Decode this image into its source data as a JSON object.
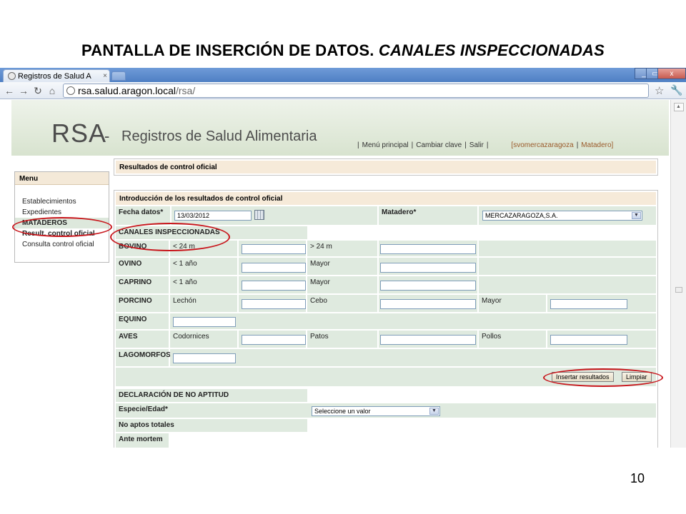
{
  "slide": {
    "title_main": "PANTALLA DE INSERCIÓN DE DATOS.",
    "title_italic": "CANALES INSPECCIONADAS",
    "page_number": "10"
  },
  "browser": {
    "tab_title": "Registros de Salud A",
    "tab_close": "×",
    "url_host": "rsa.salud.aragon.local",
    "url_path": "/rsa/",
    "window_controls": [
      "_",
      "▭",
      "x"
    ]
  },
  "site": {
    "logo_short": "RSA",
    "logo_dash": "-",
    "logo_full": "Registros de Salud Alimentaria",
    "nav": {
      "menu_principal": "Menú principal",
      "cambiar_clave": "Cambiar clave",
      "salir": "Salir",
      "user": "[svomercazaragoza",
      "role": "Matadero]",
      "separator": "|"
    }
  },
  "menu": {
    "header": "Menu",
    "items": {
      "establecimientos": "Establecimientos",
      "expedientes": "Expedientes",
      "section_mataderos": "MATADEROS",
      "result_control": "Result. control oficial",
      "consulta_control": "Consulta control oficial"
    }
  },
  "results_header": "Resultados de control oficial",
  "form": {
    "title": "Introducción de los resultados de control oficial",
    "fecha_label": "Fecha datos*",
    "fecha_value": "13/03/2012",
    "matadero_label": "Matadero*",
    "matadero_value": "MERCAZARAGOZA,S.A.",
    "canales_header": "CANALES INSPECCIONADAS",
    "rows": {
      "bovino": {
        "label": "BOVINO",
        "c1": "< 24 m",
        "c2": "> 24 m"
      },
      "ovino": {
        "label": "OVINO",
        "c1": "< 1 año",
        "c2": "Mayor"
      },
      "caprino": {
        "label": "CAPRINO",
        "c1": "< 1 año",
        "c2": "Mayor"
      },
      "porcino": {
        "label": "PORCINO",
        "c1": "Lechón",
        "c2": "Cebo",
        "c3": "Mayor"
      },
      "equino": {
        "label": "EQUINO"
      },
      "aves": {
        "label": "AVES",
        "c1": "Codornices",
        "c2": "Patos",
        "c3": "Pollos"
      },
      "lagomorfos": {
        "label": "LAGOMORFOS"
      }
    },
    "insert_button": "Insertar resultados",
    "clear_button": "Limpiar",
    "no_aptitud_header": "DECLARACIÓN DE NO APTITUD",
    "especie_label": "Especie/Edad*",
    "especie_select": "Seleccione un valor",
    "no_aptos": "No aptos totales",
    "ante_mortem": "Ante mortem"
  }
}
